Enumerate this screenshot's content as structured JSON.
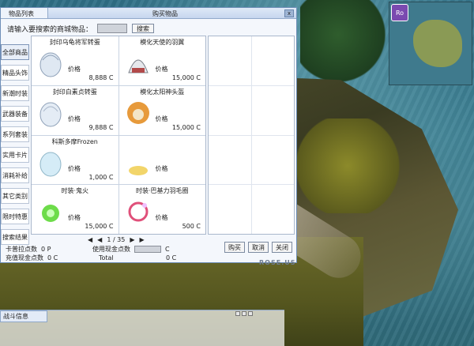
{
  "chat": {
    "tab1": "物品列表",
    "tab2": "购买物品"
  },
  "shop": {
    "title": "购买物品",
    "left_tab": "物品列表",
    "close": "x",
    "search_label": "请输入要搜索的商城物品：",
    "search_button": "搜索",
    "categories": [
      "全部商品",
      "精品头饰",
      "新潮时装",
      "武器装备",
      "系列套装",
      "实用卡片",
      "消耗补给",
      "其它类别",
      "限时特惠",
      "搜索结果"
    ],
    "items": [
      {
        "name": "封印乌龟将军转蛋",
        "price_label": "价格",
        "price": "8,888 C"
      },
      {
        "name": "模化天使的羽翼",
        "price_label": "价格",
        "price": "15,000 C"
      },
      {
        "name": "封印白素贞转蛋",
        "price_label": "价格",
        "price": "9,888 C"
      },
      {
        "name": "模化太阳神头盔",
        "price_label": "价格",
        "price": "15,000 C"
      },
      {
        "name": "科斯多摩Frozen",
        "price_label": "价格",
        "price": "1,000 C"
      },
      {
        "name": "",
        "price_label": "价格",
        "price": ""
      },
      {
        "name": "时装·鬼火",
        "price_label": "价格",
        "price": "15,000 C"
      },
      {
        "name": "时装·巴基力羽毛圈",
        "price_label": "价格",
        "price": "500 C"
      }
    ],
    "pager": {
      "first": "◀",
      "prev": "◀",
      "text": "1 / 35",
      "next": "▶",
      "last": "▶"
    },
    "points": {
      "kafra_label": "卡普拉点数",
      "kafra_value": "0 P",
      "use_label": "使用现金点数",
      "use_unit": "C",
      "cash_label": "充值现金点数",
      "cash_value": "0 C",
      "total_label": "Total",
      "total_value": "0 C"
    },
    "buttons": {
      "buy": "购买",
      "cancel": "取消",
      "close": "关闭"
    },
    "brand": "ROSE.US"
  },
  "battle": {
    "title": "战斗信息"
  },
  "minimap": {
    "badge": "Ro"
  }
}
